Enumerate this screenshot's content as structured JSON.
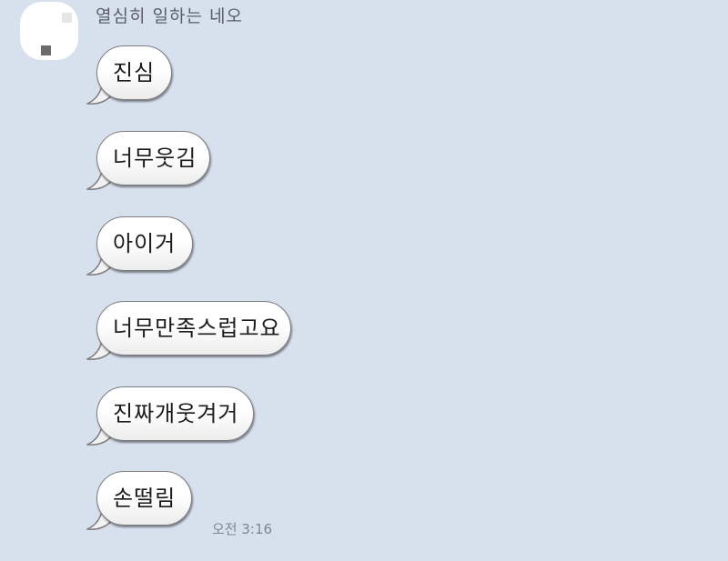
{
  "colors": {
    "background": "#d7e1ee",
    "bubble": "#ffffff",
    "bubble_border": "#7d7d7d",
    "sender_text": "#5a5f66",
    "time_text": "#7e8590"
  },
  "chat": {
    "sender_name": "열심히 일하는 네오",
    "messages": [
      {
        "text": "진심"
      },
      {
        "text": "너무웃김"
      },
      {
        "text": "아이거"
      },
      {
        "text": "너무만족스럽고요"
      },
      {
        "text": "진짜개웃겨거"
      },
      {
        "text": "손떨림"
      }
    ],
    "timestamp": "오전 3:16"
  }
}
